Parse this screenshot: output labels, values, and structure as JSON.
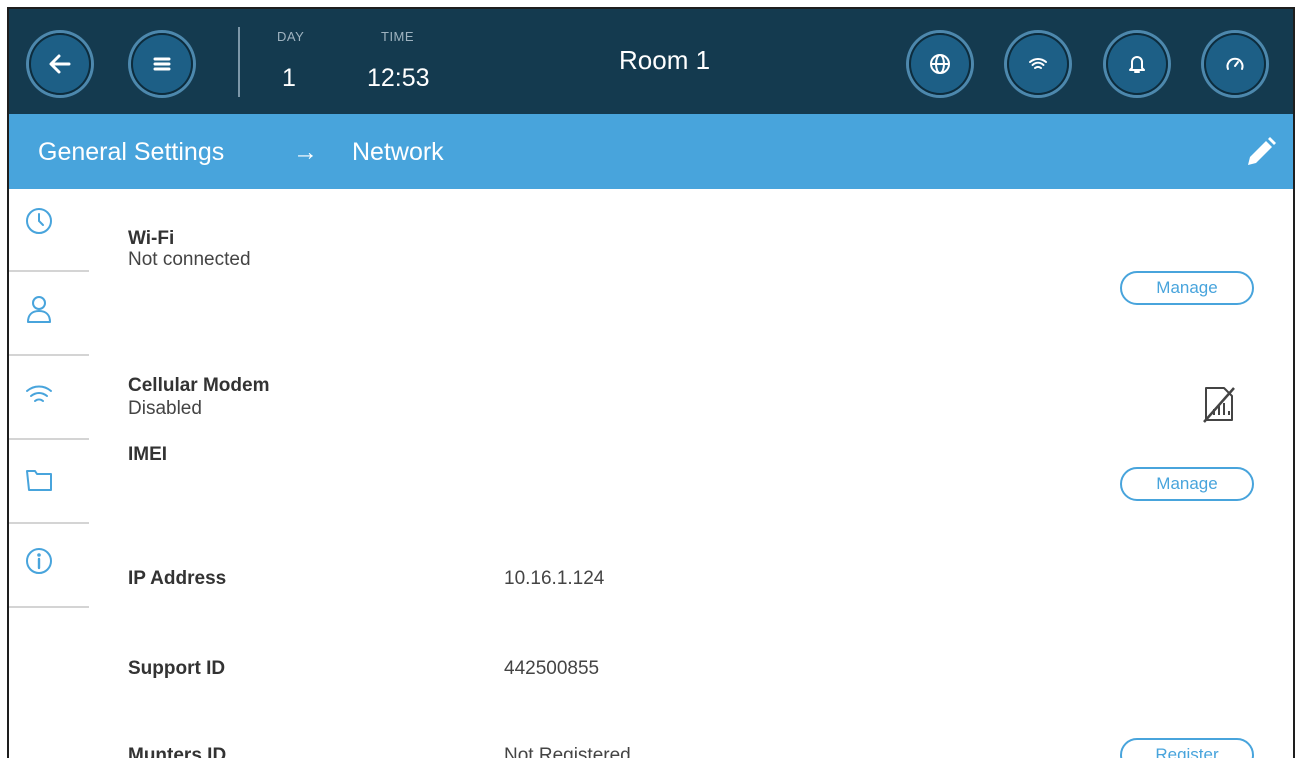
{
  "topbar": {
    "day_caption": "DAY",
    "day_value": "1",
    "time_caption": "TIME",
    "time_value": "12:53",
    "room": "Room 1"
  },
  "breadcrumb": {
    "parent": "General Settings",
    "arrow": "→",
    "current": "Network"
  },
  "sidebar": {
    "items": [
      "clock-icon",
      "user-icon",
      "wifi-icon",
      "folder-icon",
      "info-icon"
    ],
    "active": "wifi-icon"
  },
  "network": {
    "wifi": {
      "label": "Wi-Fi",
      "status": "Not connected",
      "button": "Manage"
    },
    "cellular": {
      "label": "Cellular Modem",
      "status": "Disabled",
      "button": "Manage",
      "sim_icon": "no-sim-icon"
    },
    "imei": {
      "label": "IMEI"
    },
    "ip": {
      "label": "IP Address",
      "value": "10.16.1.124"
    },
    "support": {
      "label": "Support ID",
      "value": "442500855"
    },
    "munters": {
      "label": "Munters ID",
      "value": "Not Registered",
      "button": "Register"
    }
  },
  "colors": {
    "topbar": "#143a4f",
    "accent": "#48a4dc",
    "round_button": "#1d5f86"
  }
}
